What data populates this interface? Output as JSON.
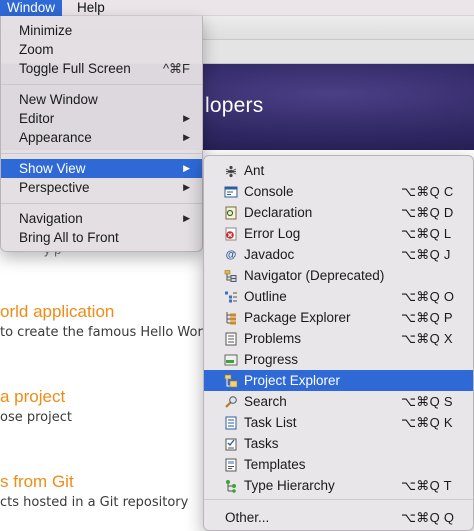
{
  "menubar": {
    "items": [
      {
        "label": "Window",
        "active": true
      },
      {
        "label": "Help",
        "active": false
      }
    ]
  },
  "banner": {
    "title_fragment": "lopers"
  },
  "content": {
    "partial_line": "y        p",
    "items": [
      {
        "title": "orld application",
        "desc": "to create the famous Hello Wor"
      },
      {
        "title": "a project",
        "desc": "ose project"
      },
      {
        "title": "s from Git",
        "desc": "cts hosted in a Git repository"
      }
    ]
  },
  "window_menu": {
    "groups": [
      [
        {
          "label": "Minimize"
        },
        {
          "label": "Zoom"
        },
        {
          "label": "Toggle Full Screen",
          "shortcut": "^⌘F"
        }
      ],
      [
        {
          "label": "New Window"
        },
        {
          "label": "Editor",
          "submenu": true
        },
        {
          "label": "Appearance",
          "submenu": true
        }
      ],
      [
        {
          "label": "Show View",
          "submenu": true,
          "selected": true
        },
        {
          "label": "Perspective",
          "submenu": true
        }
      ],
      [
        {
          "label": "Navigation",
          "submenu": true
        },
        {
          "label": "Bring All to Front"
        }
      ]
    ]
  },
  "show_view_submenu": {
    "items": [
      {
        "label": "Ant",
        "shortcut": "",
        "icon": "ant-icon"
      },
      {
        "label": "Console",
        "shortcut": "⌥⌘Q C",
        "icon": "console-icon"
      },
      {
        "label": "Declaration",
        "shortcut": "⌥⌘Q D",
        "icon": "declaration-icon"
      },
      {
        "label": "Error Log",
        "shortcut": "⌥⌘Q L",
        "icon": "error-log-icon"
      },
      {
        "label": "Javadoc",
        "shortcut": "⌥⌘Q J",
        "icon": "javadoc-icon"
      },
      {
        "label": "Navigator (Deprecated)",
        "shortcut": "",
        "icon": "navigator-icon"
      },
      {
        "label": "Outline",
        "shortcut": "⌥⌘Q O",
        "icon": "outline-icon"
      },
      {
        "label": "Package Explorer",
        "shortcut": "⌥⌘Q P",
        "icon": "package-explorer-icon"
      },
      {
        "label": "Problems",
        "shortcut": "⌥⌘Q X",
        "icon": "problems-icon"
      },
      {
        "label": "Progress",
        "shortcut": "",
        "icon": "progress-icon"
      },
      {
        "label": "Project Explorer",
        "shortcut": "",
        "icon": "project-explorer-icon",
        "selected": true
      },
      {
        "label": "Search",
        "shortcut": "⌥⌘Q S",
        "icon": "search-icon"
      },
      {
        "label": "Task List",
        "shortcut": "⌥⌘Q K",
        "icon": "task-list-icon"
      },
      {
        "label": "Tasks",
        "shortcut": "",
        "icon": "tasks-icon"
      },
      {
        "label": "Templates",
        "shortcut": "",
        "icon": "templates-icon"
      },
      {
        "label": "Type Hierarchy",
        "shortcut": "⌥⌘Q T",
        "icon": "type-hierarchy-icon"
      }
    ],
    "other": {
      "label": "Other...",
      "shortcut": "⌥⌘Q Q"
    }
  },
  "colors": {
    "selection": "#2e69d6",
    "link_orange": "#f08c14",
    "banner": "#2e2661"
  }
}
